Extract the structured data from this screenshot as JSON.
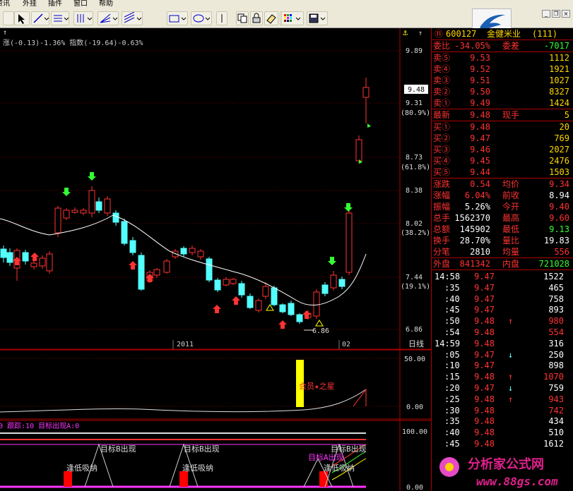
{
  "menu": [
    "资讯",
    "外挂",
    "插件",
    "窗口",
    "帮助"
  ],
  "stock": {
    "code": "600127",
    "name": "金健米业",
    "num": "(111)",
    "circle": "⑪"
  },
  "quote_top": [
    {
      "l1": "委比",
      "v1": "-34.05%",
      "l2": "委差",
      "v2": "-7017"
    }
  ],
  "sells": [
    {
      "label": "卖⑤",
      "price": "9.53",
      "vol": "1112"
    },
    {
      "label": "卖④",
      "price": "9.52",
      "vol": "1921"
    },
    {
      "label": "卖③",
      "price": "9.51",
      "vol": "1027"
    },
    {
      "label": "卖②",
      "price": "9.50",
      "vol": "8327"
    },
    {
      "label": "卖①",
      "price": "9.49",
      "vol": "1424"
    }
  ],
  "latest": {
    "l1": "最新",
    "v1": "9.48",
    "l2": "现手",
    "v2": "5"
  },
  "buys": [
    {
      "label": "买①",
      "price": "9.48",
      "vol": "20"
    },
    {
      "label": "买②",
      "price": "9.47",
      "vol": "769"
    },
    {
      "label": "买③",
      "price": "9.46",
      "vol": "2027"
    },
    {
      "label": "买④",
      "price": "9.45",
      "vol": "2476"
    },
    {
      "label": "买⑤",
      "price": "9.44",
      "vol": "1503"
    }
  ],
  "stats": [
    {
      "l1": "涨跌",
      "v1": "0.54",
      "l2": "均价",
      "v2": "9.34"
    },
    {
      "l1": "涨幅",
      "v1": "6.04%",
      "l2": "前收",
      "v2": "8.94"
    },
    {
      "l1": "振幅",
      "v1": "5.26%",
      "l2": "今开",
      "v2": "9.40"
    },
    {
      "l1": "总手",
      "v1": "1562370",
      "l2": "最高",
      "v2": "9.60"
    },
    {
      "l1": "总额",
      "v1": "145902",
      "l2": "最低",
      "v2": "9.13"
    },
    {
      "l1": "换手",
      "v1": "28.70%",
      "l2": "量比",
      "v2": "19.83"
    },
    {
      "l1": "分笔",
      "v1": "2810",
      "l2": "均量",
      "v2": "556"
    }
  ],
  "outer": {
    "l1": "外盘",
    "v1": "841342",
    "l2": "内盘",
    "v2": "721028"
  },
  "ticks": [
    {
      "t": "14:58",
      "p": "9.47",
      "a": "",
      "v": "1522",
      "c": "#fff"
    },
    {
      "t": ":35",
      "p": "9.47",
      "a": "",
      "v": "465",
      "c": "#fff"
    },
    {
      "t": ":40",
      "p": "9.47",
      "a": "",
      "v": "758",
      "c": "#fff"
    },
    {
      "t": ":45",
      "p": "9.47",
      "a": "",
      "v": "893",
      "c": "#fff"
    },
    {
      "t": ":50",
      "p": "9.48",
      "a": "↑",
      "v": "980",
      "c": "#f33"
    },
    {
      "t": ":54",
      "p": "9.48",
      "a": "",
      "v": "554",
      "c": "#f33"
    },
    {
      "t": "14:59",
      "p": "9.48",
      "a": "",
      "v": "316",
      "c": "#fff"
    },
    {
      "t": ":05",
      "p": "9.47",
      "a": "↓",
      "v": "250",
      "c": "#fff"
    },
    {
      "t": ":10",
      "p": "9.47",
      "a": "",
      "v": "898",
      "c": "#fff"
    },
    {
      "t": ":15",
      "p": "9.48",
      "a": "↑",
      "v": "1070",
      "c": "#f33"
    },
    {
      "t": ":20",
      "p": "9.47",
      "a": "↓",
      "v": "759",
      "c": "#fff"
    },
    {
      "t": ":25",
      "p": "9.48",
      "a": "↑",
      "v": "943",
      "c": "#f33"
    },
    {
      "t": ":30",
      "p": "9.48",
      "a": "",
      "v": "742",
      "c": "#f33"
    },
    {
      "t": ":35",
      "p": "9.48",
      "a": "",
      "v": "434",
      "c": "#fff"
    },
    {
      "t": ":40",
      "p": "9.48",
      "a": "",
      "v": "510",
      "c": "#fff"
    },
    {
      "t": ":45",
      "p": "9.48",
      "a": "",
      "v": "1612",
      "c": "#fff"
    }
  ],
  "header_text": "涨(-0.13)-1.36% 指数(-19.64)-0.63%",
  "price_axis": [
    "9.89",
    "9.31",
    "8.73",
    "8.38",
    "8.02",
    "7.44",
    "6.86"
  ],
  "pct_labels": [
    "(80.9%)",
    "(61.8%)",
    "(38.2%)",
    "(19.1%)"
  ],
  "current_price": "9.48",
  "low_label": "6.86",
  "time_labels": [
    "2011",
    "02"
  ],
  "period_label": "日线",
  "ind1_axis": [
    "50.00",
    "0.00"
  ],
  "ind1_label": "会员★之星",
  "ind2_header": "0 跟踪:10 目标出现A:0",
  "ind2_axis": [
    "100.00",
    "0.00"
  ],
  "ind2_labels": [
    "目标B出现",
    "目标B出现",
    "逢低吸纳",
    "逢低吸纳",
    "目标A出现",
    "目标B出现",
    "逢低吸纳"
  ],
  "watermark": {
    "brand": "分析家公式网",
    "url": "www.88gs.com"
  },
  "colors": {
    "up": "#ff3232",
    "down": "#54ffff",
    "bg": "#000000",
    "axis": "#a00000",
    "text": "#e0e0e0"
  }
}
